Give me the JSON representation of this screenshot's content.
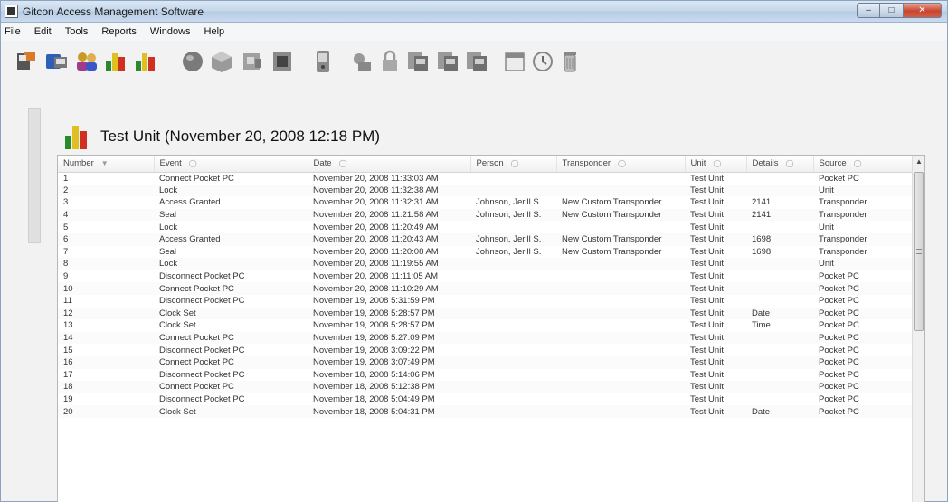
{
  "window": {
    "title": "Gitcon Access Management Software"
  },
  "menu": [
    {
      "label": "File"
    },
    {
      "label": "Edit"
    },
    {
      "label": "Tools"
    },
    {
      "label": "Reports"
    },
    {
      "label": "Windows"
    },
    {
      "label": "Help"
    }
  ],
  "toolbar_icons": [
    "unit-reader-icon",
    "transfer-icon",
    "users-icon",
    "unit-report-icon",
    "unit-report-icon-2",
    "globe-icon",
    "package-icon",
    "device-icon",
    "device-dark-icon",
    "pocket-device-icon",
    "key-lock-icon",
    "padlock-icon",
    "copy-icon",
    "copy-icon-2",
    "copy-icon-3",
    "calendar-icon",
    "clock-icon",
    "trash-icon"
  ],
  "header": {
    "title": "Test Unit (November 20, 2008 12:18 PM)"
  },
  "table": {
    "columns": [
      "Number",
      "Event",
      "Date",
      "Person",
      "Transponder",
      "Unit",
      "Details",
      "Source"
    ],
    "rows": [
      [
        "1",
        "Connect Pocket PC",
        "November 20, 2008 11:33:03 AM",
        "",
        "",
        "Test Unit",
        "",
        "Pocket PC"
      ],
      [
        "2",
        "Lock",
        "November 20, 2008 11:32:38 AM",
        "",
        "",
        "Test Unit",
        "",
        "Unit"
      ],
      [
        "3",
        "Access Granted",
        "November 20, 2008 11:32:31 AM",
        "Johnson, Jerill  S.",
        "New Custom Transponder",
        "Test Unit",
        "2141",
        "Transponder"
      ],
      [
        "4",
        "Seal",
        "November 20, 2008 11:21:58 AM",
        "Johnson, Jerill  S.",
        "New Custom Transponder",
        "Test Unit",
        "2141",
        "Transponder"
      ],
      [
        "5",
        "Lock",
        "November 20, 2008 11:20:49 AM",
        "",
        "",
        "Test Unit",
        "",
        "Unit"
      ],
      [
        "6",
        "Access Granted",
        "November 20, 2008 11:20:43 AM",
        "Johnson, Jerill  S.",
        "New Custom Transponder",
        "Test Unit",
        "1698",
        "Transponder"
      ],
      [
        "7",
        "Seal",
        "November 20, 2008 11:20:08 AM",
        "Johnson, Jerill  S.",
        "New Custom Transponder",
        "Test Unit",
        "1698",
        "Transponder"
      ],
      [
        "8",
        "Lock",
        "November 20, 2008 11:19:55 AM",
        "",
        "",
        "Test Unit",
        "",
        "Unit"
      ],
      [
        "9",
        "Disconnect Pocket PC",
        "November 20, 2008 11:11:05 AM",
        "",
        "",
        "Test Unit",
        "",
        "Pocket PC"
      ],
      [
        "10",
        "Connect Pocket PC",
        "November 20, 2008 11:10:29 AM",
        "",
        "",
        "Test Unit",
        "",
        "Pocket PC"
      ],
      [
        "11",
        "Disconnect Pocket PC",
        "November 19, 2008 5:31:59 PM",
        "",
        "",
        "Test Unit",
        "",
        "Pocket PC"
      ],
      [
        "12",
        "Clock Set",
        "November 19, 2008 5:28:57 PM",
        "",
        "",
        "Test Unit",
        "Date",
        "Pocket PC"
      ],
      [
        "13",
        "Clock Set",
        "November 19, 2008 5:28:57 PM",
        "",
        "",
        "Test Unit",
        "Time",
        "Pocket PC"
      ],
      [
        "14",
        "Connect Pocket PC",
        "November 19, 2008 5:27:09 PM",
        "",
        "",
        "Test Unit",
        "",
        "Pocket PC"
      ],
      [
        "15",
        "Disconnect Pocket PC",
        "November 19, 2008 3:09:22 PM",
        "",
        "",
        "Test Unit",
        "",
        "Pocket PC"
      ],
      [
        "16",
        "Connect Pocket PC",
        "November 19, 2008 3:07:49 PM",
        "",
        "",
        "Test Unit",
        "",
        "Pocket PC"
      ],
      [
        "17",
        "Disconnect Pocket PC",
        "November 18, 2008 5:14:06 PM",
        "",
        "",
        "Test Unit",
        "",
        "Pocket PC"
      ],
      [
        "18",
        "Connect Pocket PC",
        "November 18, 2008 5:12:38 PM",
        "",
        "",
        "Test Unit",
        "",
        "Pocket PC"
      ],
      [
        "19",
        "Disconnect Pocket PC",
        "November 18, 2008 5:04:49 PM",
        "",
        "",
        "Test Unit",
        "",
        "Pocket PC"
      ],
      [
        "20",
        "Clock Set",
        "November 18, 2008 5:04:31 PM",
        "",
        "",
        "Test Unit",
        "Date",
        "Pocket PC"
      ]
    ]
  },
  "colors": {
    "titlebar": "#c4d6ea",
    "close": "#c8452f",
    "grid_border": "#b7b7b7"
  }
}
